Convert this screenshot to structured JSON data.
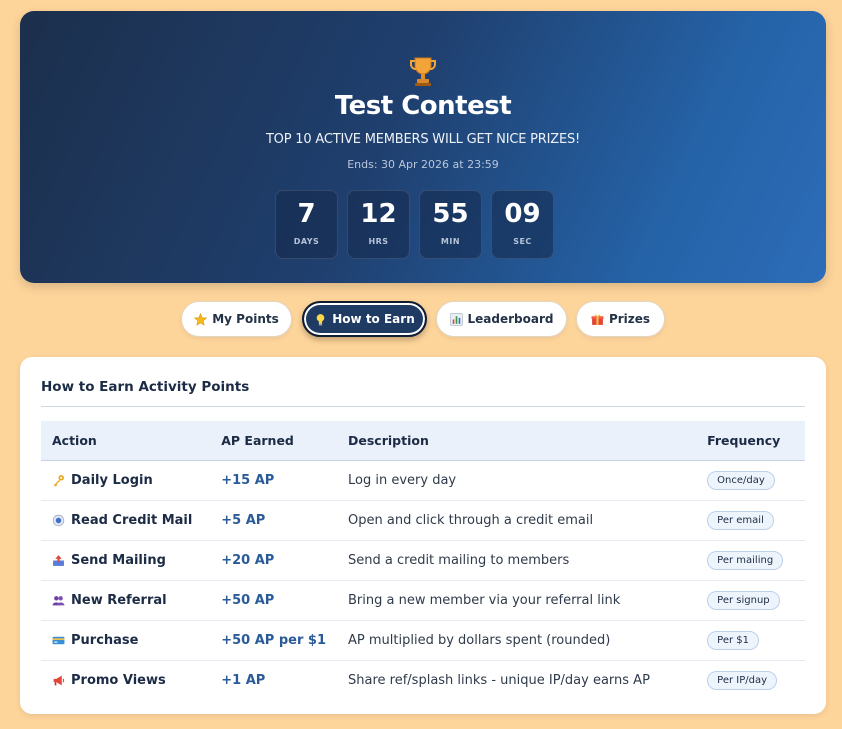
{
  "hero": {
    "title": "Test Contest",
    "subtitle": "TOP 10 ACTIVE MEMBERS WILL GET NICE PRIZES!",
    "ends": "Ends: 30 Apr 2026 at 23:59",
    "icon": "trophy-icon",
    "countdown": [
      {
        "value": "7",
        "label": "DAYS"
      },
      {
        "value": "12",
        "label": "HRS"
      },
      {
        "value": "55",
        "label": "MIN"
      },
      {
        "value": "09",
        "label": "SEC"
      }
    ]
  },
  "tabs": [
    {
      "label": "My Points",
      "icon": "star-icon",
      "active": false
    },
    {
      "label": "How to Earn",
      "icon": "lightbulb-icon",
      "active": true
    },
    {
      "label": "Leaderboard",
      "icon": "bar-chart-icon",
      "active": false
    },
    {
      "label": "Prizes",
      "icon": "gift-icon",
      "active": false
    }
  ],
  "earn": {
    "title": "How to Earn Activity Points",
    "columns": [
      "Action",
      "AP Earned",
      "Description",
      "Frequency"
    ],
    "rows": [
      {
        "icon": "key-icon",
        "action": "Daily Login",
        "ap": "+15 AP",
        "description": "Log in every day",
        "frequency": "Once/day"
      },
      {
        "icon": "mail-icon",
        "action": "Read Credit Mail",
        "ap": "+5 AP",
        "description": "Open and click through a credit email",
        "frequency": "Per email"
      },
      {
        "icon": "outbox-icon",
        "action": "Send Mailing",
        "ap": "+20 AP",
        "description": "Send a credit mailing to members",
        "frequency": "Per mailing"
      },
      {
        "icon": "people-icon",
        "action": "New Referral",
        "ap": "+50 AP",
        "description": "Bring a new member via your referral link",
        "frequency": "Per signup"
      },
      {
        "icon": "credit-card-icon",
        "action": "Purchase",
        "ap": "+50 AP per $1",
        "description": "AP multiplied by dollars spent (rounded)",
        "frequency": "Per $1"
      },
      {
        "icon": "megaphone-icon",
        "action": "Promo Views",
        "ap": "+1 AP",
        "description": "Share ref/splash links - unique IP/day earns AP",
        "frequency": "Per IP/day"
      }
    ]
  },
  "colors": {
    "page_bg": "#fdd49a",
    "hero_dark": "#1c2f4c",
    "hero_light": "#2d6cb8",
    "accent_ap": "#2a5a98",
    "active_tab": "#1f3a63"
  }
}
